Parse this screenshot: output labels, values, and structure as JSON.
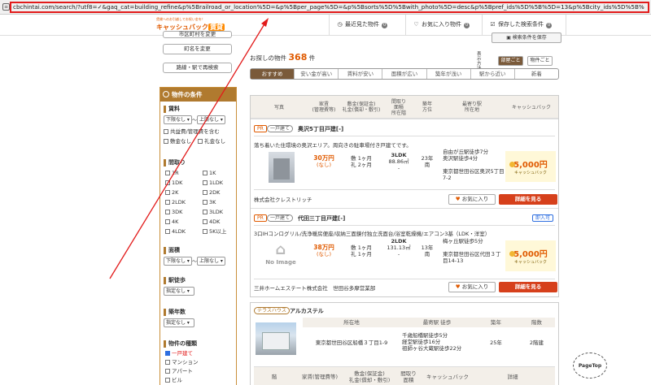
{
  "browser": {
    "url": "cbchintai.com/search/?utf8=✓&gaq_cat=building_refine&p%5Brailroad_or_location%5D=&p%5Bper_page%5D=&p%5Bsorts%5D%5Bwith_photo%5D=desc&p%5Bpref_ids%5D%5B%5D=13&p%5Bcity_ids%5D%5B%"
  },
  "header": {
    "logo_sub": "賃貸へのお引越しでお祝い金を！",
    "logo_main": "キャッシュバック",
    "logo_badge": "賃貸",
    "recent": "最近見た物件",
    "recent_count": "0",
    "favorites": "お気に入り物件",
    "favorites_count": "0",
    "saved": "保存した検索条件",
    "saved_count": "0",
    "save_button": "検索条件を保存"
  },
  "sidebar": {
    "top_button_partial": "市区町村を変更",
    "town_button": "町名を変更",
    "route_button": "路線・駅で再検索",
    "conditions_title": "物件の条件",
    "rent": {
      "title": "賃料",
      "from": "下限なし",
      "to": "上限なし",
      "tilde": "〜",
      "options": [
        "共益費/管理費を含む",
        "敷金なし",
        "礼金なし"
      ]
    },
    "layout": {
      "title": "間取り",
      "options": [
        "1R",
        "1K",
        "1DK",
        "1LDK",
        "2K",
        "2DK",
        "2LDK",
        "3K",
        "3DK",
        "3LDK",
        "4K",
        "4DK",
        "4LDK",
        "5K以上"
      ]
    },
    "area": {
      "title": "面積",
      "from": "下限なし",
      "to": "上限なし",
      "tilde": "〜"
    },
    "walk": {
      "title": "駅徒歩",
      "value": "指定なし"
    },
    "age": {
      "title": "築年数",
      "value": "指定なし"
    },
    "type": {
      "title": "物件の種類",
      "options": [
        {
          "label": "一戸建て",
          "checked": true
        },
        {
          "label": "マンション",
          "checked": false
        },
        {
          "label": "アパート",
          "checked": false
        },
        {
          "label": "ビル",
          "checked": false
        }
      ]
    }
  },
  "results": {
    "count_label": "お探しの物件",
    "count": "368",
    "count_unit": "件",
    "sort_label": "表示方法",
    "view_by_room": "部屋ごと",
    "view_by_building": "物件ごと",
    "sort_tabs": [
      "おすすめ",
      "安い金が高い",
      "賃料が安い",
      "面積が広い",
      "築年が浅い",
      "駅から近い",
      "新着"
    ],
    "columns": [
      "写真",
      "家賃\n(管理費等)",
      "敷金(保証金)\n礼金(償却・敷引)",
      "間取り\n面積\n所在階",
      "築年\n方位",
      "最寄り駅\n所在地",
      "キャッシュバック"
    ],
    "cards": [
      {
        "badge1": "PR",
        "badge2": "一戸建て",
        "title": "奥沢5丁目戸建[-]",
        "description": "落ち着いた住環境の奥沢エリア。周向きの駐車場付き戸建てです。",
        "rent": "30万円",
        "fee": "(なし)",
        "deposit": "敷 1ヶ月",
        "key_money": "礼 2ヶ月",
        "layout": "3LDK",
        "area": "88.86㎡",
        "floor": "-",
        "age": "23年",
        "direction": "南",
        "station1": "自由が丘駅徒歩7分",
        "station2": "奥沢駅徒歩4分",
        "address": "東京都世田谷区奥沢5丁目7-2",
        "cashback": "5,000円",
        "cashback_label": "キャッシュバック",
        "company": "株式会社クレストリッチ",
        "fav_button": "お気に入り",
        "detail_button": "詳細を見る"
      },
      {
        "badge1": "PR",
        "badge2": "一戸建て",
        "title": "代田三丁目戸建[-]",
        "tag": "即入可",
        "description": "3口IHコンログリル/洗浄暖房便座/収納三面鏡付独立洗面台/浴室乾燥機/エアコン3基（LDK・洋室）",
        "no_image": "No Image",
        "rent": "38万円",
        "fee": "(なし)",
        "deposit": "敷 1ヶ月",
        "key_money": "礼 1ヶ月",
        "layout": "2LDK",
        "area": "131.13㎡",
        "floor": "-",
        "age": "13年",
        "direction": "南",
        "station1": "梅ヶ丘駅徒歩5分",
        "station2": "",
        "address": "東京都世田谷区代田３丁目14-13",
        "cashback": "5,000円",
        "cashback_label": "キャッシュバック",
        "company": "三井ホームエステート株式会社　世田谷多摩営業部",
        "fav_button": "お気に入り",
        "detail_button": "詳細を見る"
      }
    ],
    "building": {
      "badge": "テラスハウス",
      "title": "アルカステル",
      "col_address": "所在地",
      "col_station": "最寄駅 徒歩",
      "col_age": "築年",
      "col_floors": "階数",
      "address": "東京都世田谷区船橋３丁目1-9",
      "station1": "千歳船橋駅徒歩5分",
      "station2": "経堂駅徒歩16分",
      "station3": "祖師ヶ谷大蔵駅徒歩22分",
      "age": "25年",
      "floors": "2階建",
      "sub_cols": [
        "階",
        "家賃(管理費等)",
        "敷金(保証金)\n礼金(償却・敷引)",
        "間取り\n面積",
        "キャッシュバック",
        "詳細"
      ]
    }
  },
  "pagetop": "PageTop"
}
